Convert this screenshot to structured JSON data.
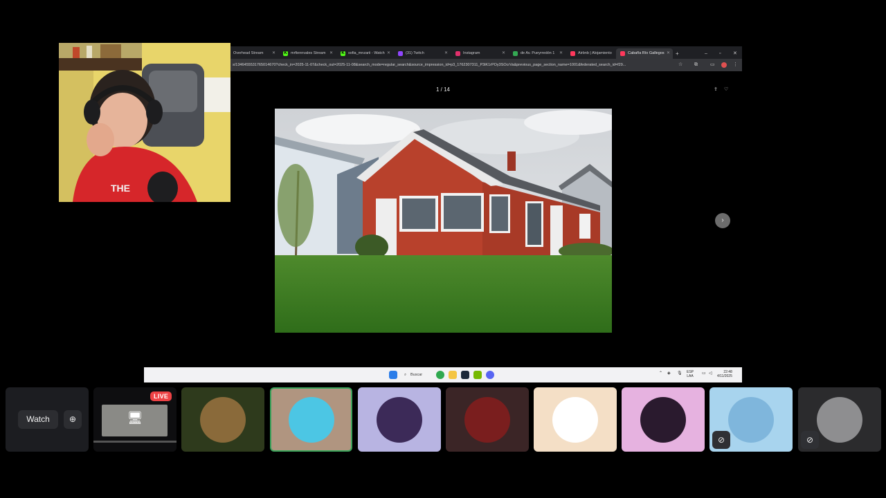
{
  "browser": {
    "tabs": [
      {
        "label": "Overhead Stream",
        "fav_color": "#3a3a3a",
        "fav_glyph": "",
        "active": false
      },
      {
        "label": "mrfiennvales Stream",
        "fav_color": "#53fc18",
        "fav_glyph": "K",
        "active": false
      },
      {
        "label": "sofia_mnzarii - Watch",
        "fav_color": "#53fc18",
        "fav_glyph": "K",
        "active": false
      },
      {
        "label": "(31) Twitch",
        "fav_color": "#9146ff",
        "fav_glyph": "",
        "active": false
      },
      {
        "label": "Instagram",
        "fav_color": "#e1306c",
        "fav_glyph": "",
        "active": false
      },
      {
        "label": "de Av. Pueyrredón 1",
        "fav_color": "#34a853",
        "fav_glyph": "",
        "active": false
      },
      {
        "label": "Airbnb | Alojamiento",
        "fav_color": "#ff385c",
        "fav_glyph": "",
        "active": false
      },
      {
        "label": "Cabaña Río Gallegos",
        "fav_color": "#ff385c",
        "fav_glyph": "",
        "active": true
      }
    ],
    "url": "s/1346455531765014670?check_in=2025-11-07&check_out=2025-11-08&search_mode=regular_search&source_impression_id=p3_1762307311_P3iK1rPOy3SOcrVa&previous_page_section_name=1001&federated_search_id=f29..."
  },
  "gallery": {
    "counter": "1 / 14"
  },
  "taskbar": {
    "search_label": "Buscar",
    "lang_line1": "ESP",
    "lang_line2": "LAA",
    "time": "22:48",
    "date": "4/11/2025"
  },
  "stream_tile": {
    "watch_label": "Watch",
    "live_label": "LIVE"
  },
  "participants": [
    {
      "tile_bg": "#2e3a1c",
      "avatar": "owl-fantasy-avatar"
    },
    {
      "tile_bg": "#b09580",
      "avatar": "blue-hair-avatar",
      "speaking": true
    },
    {
      "tile_bg": "#b8b4e2",
      "avatar": "game-character-avatar"
    },
    {
      "tile_bg": "#3b2526",
      "avatar": "red-ninja-avatar"
    },
    {
      "tile_bg": "#f4dfc6",
      "avatar": "cartoon-teacher-avatar"
    },
    {
      "tile_bg": "#e6b2e0",
      "avatar": "anime-avatar"
    },
    {
      "tile_bg": "#a8d4ee",
      "avatar": "man-blue-shirt-avatar",
      "muted": true
    },
    {
      "tile_bg": "#2b2b2d",
      "avatar": "koala-avatar",
      "muted": true
    }
  ]
}
